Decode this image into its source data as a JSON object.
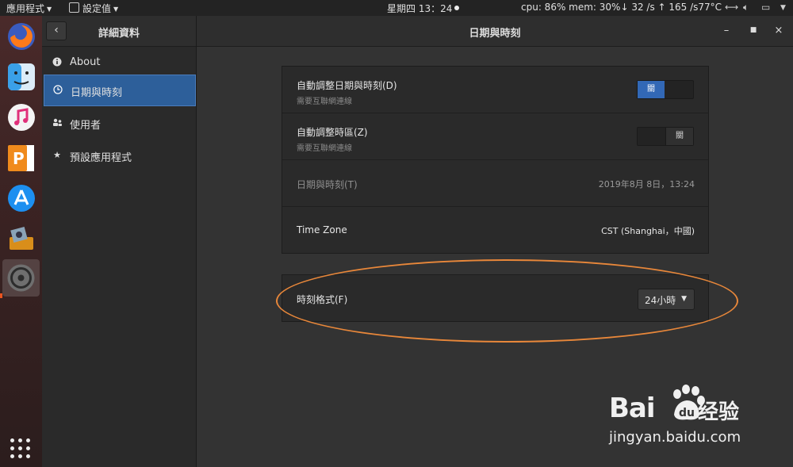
{
  "topbar": {
    "apps_menu": "應用程式",
    "settings_menu": "設定值",
    "clock": "星期四 13：24",
    "sysmon": "cpu: 86% mem: 30%↓  32 /s ↑ 165 /s77°C"
  },
  "sidebar": {
    "title": "詳細資料",
    "items": [
      {
        "label": "About",
        "icon": "info-icon"
      },
      {
        "label": "日期與時刻",
        "icon": "clock-icon"
      },
      {
        "label": "使用者",
        "icon": "users-icon"
      },
      {
        "label": "預設應用程式",
        "icon": "star-icon"
      }
    ]
  },
  "main": {
    "title": "日期與時刻",
    "auto_datetime": {
      "label": "自動調整日期與時刻(D)",
      "sub": "需要互聯網連線",
      "state": "關"
    },
    "auto_timezone": {
      "label": "自動調整時區(Z)",
      "sub": "需要互聯網連線",
      "state": "關"
    },
    "datetime": {
      "label": "日期與時刻(T)",
      "value": "2019年8月 8日，13:24"
    },
    "timezone": {
      "label": "Time Zone",
      "value": "CST (Shanghai，中國)"
    },
    "time_format": {
      "label": "時刻格式(F)",
      "value": "24小時"
    }
  },
  "watermark": {
    "brand": "Bai",
    "brand_suffix": "经验",
    "url": "jingyan.baidu.com",
    "paw_text": "du"
  },
  "colors": {
    "accent": "#3268b6",
    "highlight": "#e8873a",
    "selection": "#2d5f9a"
  }
}
